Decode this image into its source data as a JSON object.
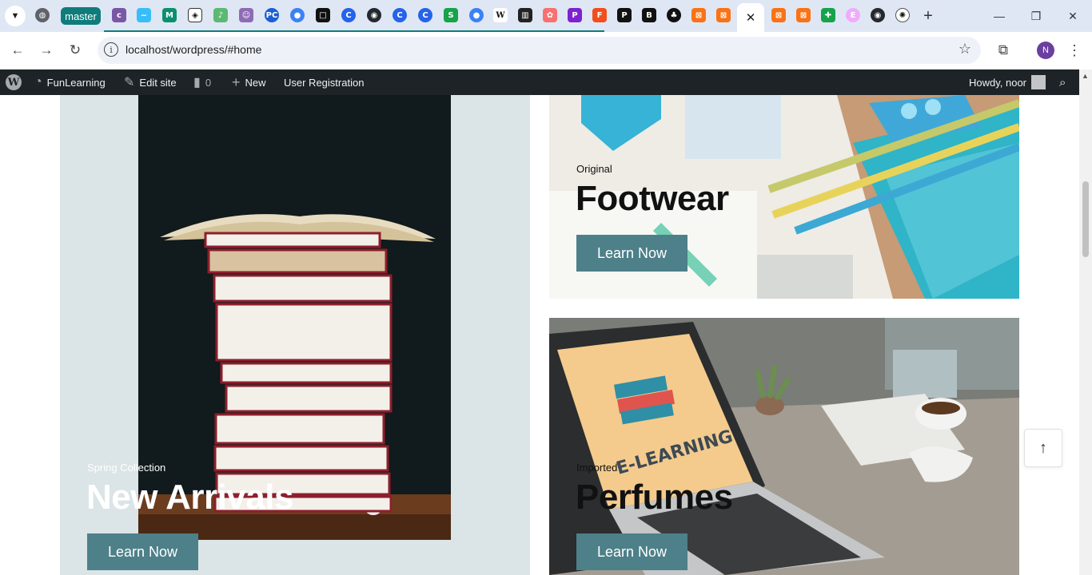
{
  "browser": {
    "branch_tab_label": "master",
    "url": "localhost/wordpress/#home",
    "profile_initial": "N",
    "tab_icons": [
      "globe-icon",
      "colorlib-icon",
      "tailwind-icon",
      "n-icon",
      "codepen-icon",
      "app-icon",
      "avatar-icon",
      "pc-icon",
      "blue-circle-icon",
      "notion-icon",
      "c-icon",
      "github-icon",
      "c-icon",
      "c-icon",
      "s-icon",
      "blue-circle-icon",
      "wikipedia-icon",
      "grid-icon",
      "paint-icon",
      "pg-icon",
      "figma-icon",
      "p-icon",
      "b-icon",
      "leaf-icon",
      "box-icon",
      "box-icon"
    ],
    "tab_icons_after": [
      "box-icon",
      "box-icon",
      "plus-box-icon",
      "elementor-icon",
      "github-icon",
      "openai-icon"
    ]
  },
  "adminbar": {
    "site_name": "FunLearning",
    "edit_site": "Edit site",
    "comments_count": "0",
    "new_label": "New",
    "user_registration": "User Registration",
    "howdy": "Howdy, noor"
  },
  "cards": {
    "left": {
      "eyebrow": "Spring Collection",
      "title": "New Arrivals",
      "button": "Learn Now"
    },
    "top_right": {
      "eyebrow": "Original",
      "title": "Footwear",
      "button": "Learn Now"
    },
    "bottom_right": {
      "eyebrow": "Imported",
      "title": "Perfumes",
      "button": "Learn Now",
      "screen_text": "E-LEARNING"
    }
  },
  "scroll_top_glyph": "↑",
  "colors": {
    "button": "#4d8089",
    "adminbar": "#1d2327",
    "left_card_bg": "#dbe4e6"
  }
}
